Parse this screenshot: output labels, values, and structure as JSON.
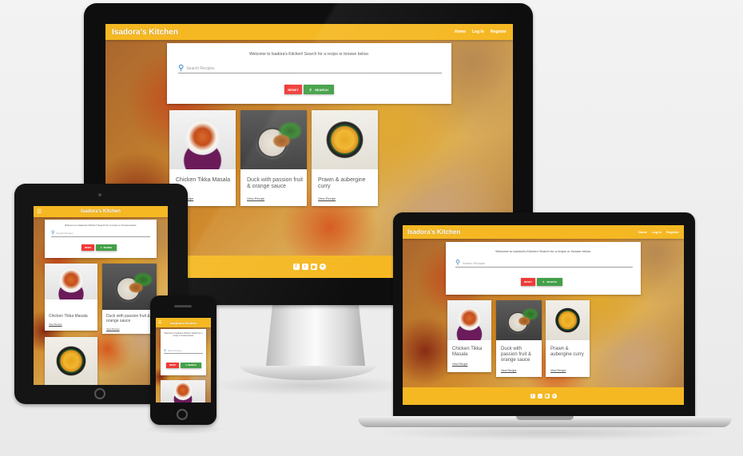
{
  "site": {
    "brand": "Isadora's Kitchen",
    "nav": [
      "Home",
      "Log In",
      "Register"
    ],
    "welcome": "Welcome to Isadora's Kitchen! Search for a recipe or browse below.",
    "search_placeholder": "Search Recipes",
    "reset_label": "RESET",
    "search_label": "SEARCH",
    "recipes": [
      {
        "title": "Chicken Tikka Masala",
        "link": "View Recipe",
        "image": "chicken-tikka-masala-photo"
      },
      {
        "title": "Duck with passion fruit & orange sauce",
        "link": "View Recipe",
        "image": "duck-passion-fruit-photo"
      },
      {
        "title": "Prawn & aubergine curry",
        "link": "View Recipe",
        "image": "prawn-aubergine-curry-photo"
      }
    ],
    "social_icons": [
      "facebook-icon",
      "twitter-icon",
      "instagram-icon",
      "github-icon"
    ],
    "mobile_welcome": "Welcome to Isadora's Kitchen! Search for a recipe or browse below."
  },
  "colors": {
    "nav": "#f5b823",
    "reset": "#ef3b36",
    "search": "#43a047",
    "device": "#0e0e0e"
  },
  "devices": [
    "monitor",
    "laptop",
    "tablet",
    "phone"
  ]
}
